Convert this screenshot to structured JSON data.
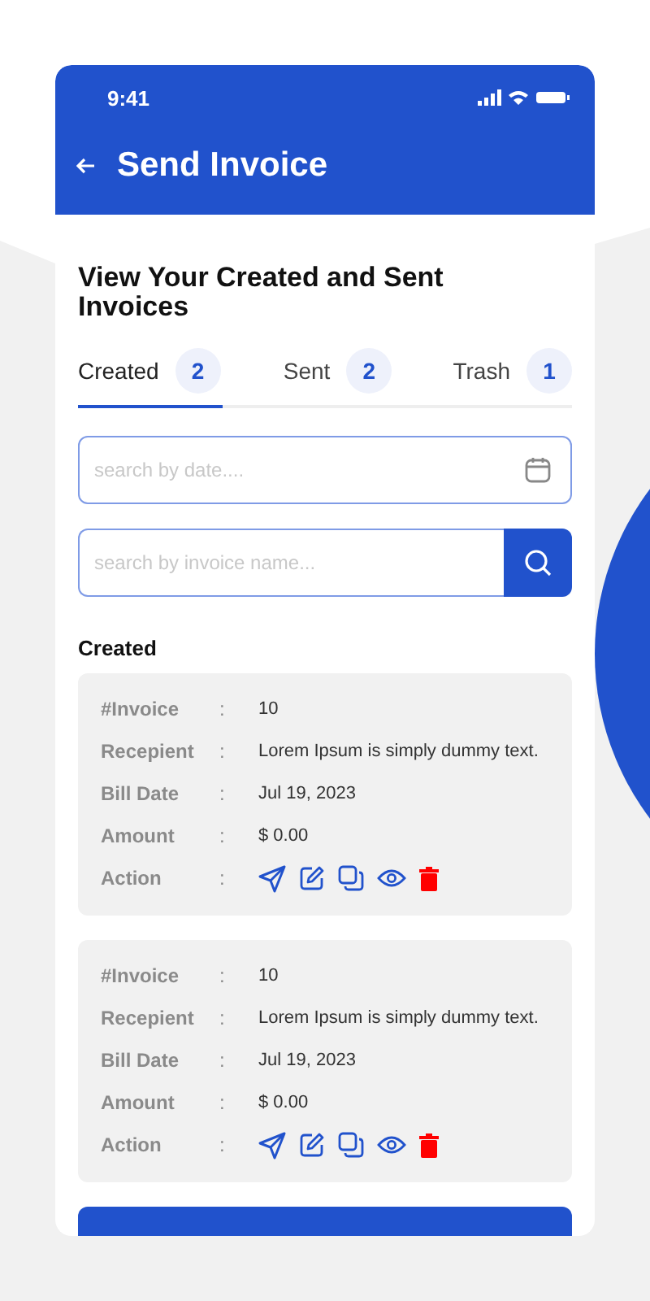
{
  "status_bar": {
    "time": "9:41"
  },
  "header": {
    "title": "Send Invoice"
  },
  "heading": "View Your Created and Sent Invoices",
  "tabs": [
    {
      "label": "Created",
      "count": "2",
      "selected": true
    },
    {
      "label": "Sent",
      "count": "2",
      "selected": false
    },
    {
      "label": "Trash",
      "count": "1",
      "selected": false
    }
  ],
  "date_field": {
    "placeholder": "search by date...."
  },
  "search_field": {
    "placeholder": "search by invoice name..."
  },
  "section_title": "Created",
  "invoices": [
    {
      "rows": [
        {
          "kind": "text",
          "label": "#Invoice",
          "separator": ":",
          "value": "10"
        },
        {
          "kind": "text",
          "label": "Recepient",
          "separator": ":",
          "value": "Lorem Ipsum is simply dummy text."
        },
        {
          "kind": "text",
          "label": "Bill Date",
          "separator": ":",
          "value": "Jul 19, 2023"
        },
        {
          "kind": "text",
          "label": "Amount",
          "separator": ":",
          "value": "$ 0.00"
        },
        {
          "kind": "actions",
          "label": "Action",
          "separator": ":"
        }
      ]
    },
    {
      "rows": [
        {
          "kind": "text",
          "label": "#Invoice",
          "separator": ":",
          "value": "10"
        },
        {
          "kind": "text",
          "label": "Recepient",
          "separator": ":",
          "value": "Lorem Ipsum is simply dummy text."
        },
        {
          "kind": "text",
          "label": "Bill Date",
          "separator": ":",
          "value": "Jul 19, 2023"
        },
        {
          "kind": "text",
          "label": "Amount",
          "separator": ":",
          "value": "$ 0.00"
        },
        {
          "kind": "actions",
          "label": "Action",
          "separator": ":"
        }
      ]
    }
  ]
}
